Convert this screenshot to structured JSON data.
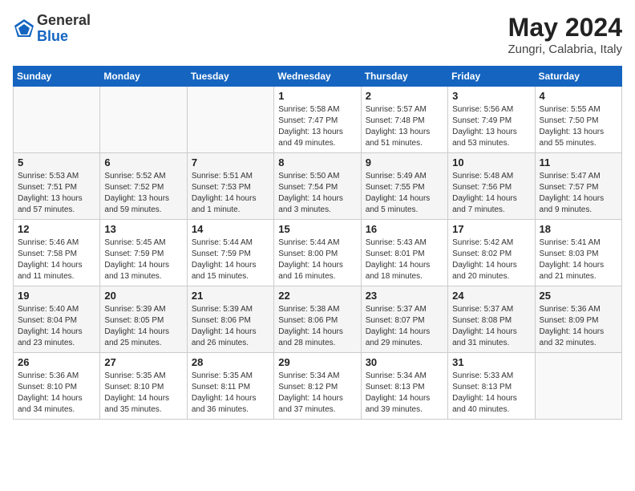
{
  "header": {
    "logo_general": "General",
    "logo_blue": "Blue",
    "month_title": "May 2024",
    "location": "Zungri, Calabria, Italy"
  },
  "weekdays": [
    "Sunday",
    "Monday",
    "Tuesday",
    "Wednesday",
    "Thursday",
    "Friday",
    "Saturday"
  ],
  "weeks": [
    [
      {
        "day": "",
        "info": ""
      },
      {
        "day": "",
        "info": ""
      },
      {
        "day": "",
        "info": ""
      },
      {
        "day": "1",
        "info": "Sunrise: 5:58 AM\nSunset: 7:47 PM\nDaylight: 13 hours\nand 49 minutes."
      },
      {
        "day": "2",
        "info": "Sunrise: 5:57 AM\nSunset: 7:48 PM\nDaylight: 13 hours\nand 51 minutes."
      },
      {
        "day": "3",
        "info": "Sunrise: 5:56 AM\nSunset: 7:49 PM\nDaylight: 13 hours\nand 53 minutes."
      },
      {
        "day": "4",
        "info": "Sunrise: 5:55 AM\nSunset: 7:50 PM\nDaylight: 13 hours\nand 55 minutes."
      }
    ],
    [
      {
        "day": "5",
        "info": "Sunrise: 5:53 AM\nSunset: 7:51 PM\nDaylight: 13 hours\nand 57 minutes."
      },
      {
        "day": "6",
        "info": "Sunrise: 5:52 AM\nSunset: 7:52 PM\nDaylight: 13 hours\nand 59 minutes."
      },
      {
        "day": "7",
        "info": "Sunrise: 5:51 AM\nSunset: 7:53 PM\nDaylight: 14 hours\nand 1 minute."
      },
      {
        "day": "8",
        "info": "Sunrise: 5:50 AM\nSunset: 7:54 PM\nDaylight: 14 hours\nand 3 minutes."
      },
      {
        "day": "9",
        "info": "Sunrise: 5:49 AM\nSunset: 7:55 PM\nDaylight: 14 hours\nand 5 minutes."
      },
      {
        "day": "10",
        "info": "Sunrise: 5:48 AM\nSunset: 7:56 PM\nDaylight: 14 hours\nand 7 minutes."
      },
      {
        "day": "11",
        "info": "Sunrise: 5:47 AM\nSunset: 7:57 PM\nDaylight: 14 hours\nand 9 minutes."
      }
    ],
    [
      {
        "day": "12",
        "info": "Sunrise: 5:46 AM\nSunset: 7:58 PM\nDaylight: 14 hours\nand 11 minutes."
      },
      {
        "day": "13",
        "info": "Sunrise: 5:45 AM\nSunset: 7:59 PM\nDaylight: 14 hours\nand 13 minutes."
      },
      {
        "day": "14",
        "info": "Sunrise: 5:44 AM\nSunset: 7:59 PM\nDaylight: 14 hours\nand 15 minutes."
      },
      {
        "day": "15",
        "info": "Sunrise: 5:44 AM\nSunset: 8:00 PM\nDaylight: 14 hours\nand 16 minutes."
      },
      {
        "day": "16",
        "info": "Sunrise: 5:43 AM\nSunset: 8:01 PM\nDaylight: 14 hours\nand 18 minutes."
      },
      {
        "day": "17",
        "info": "Sunrise: 5:42 AM\nSunset: 8:02 PM\nDaylight: 14 hours\nand 20 minutes."
      },
      {
        "day": "18",
        "info": "Sunrise: 5:41 AM\nSunset: 8:03 PM\nDaylight: 14 hours\nand 21 minutes."
      }
    ],
    [
      {
        "day": "19",
        "info": "Sunrise: 5:40 AM\nSunset: 8:04 PM\nDaylight: 14 hours\nand 23 minutes."
      },
      {
        "day": "20",
        "info": "Sunrise: 5:39 AM\nSunset: 8:05 PM\nDaylight: 14 hours\nand 25 minutes."
      },
      {
        "day": "21",
        "info": "Sunrise: 5:39 AM\nSunset: 8:06 PM\nDaylight: 14 hours\nand 26 minutes."
      },
      {
        "day": "22",
        "info": "Sunrise: 5:38 AM\nSunset: 8:06 PM\nDaylight: 14 hours\nand 28 minutes."
      },
      {
        "day": "23",
        "info": "Sunrise: 5:37 AM\nSunset: 8:07 PM\nDaylight: 14 hours\nand 29 minutes."
      },
      {
        "day": "24",
        "info": "Sunrise: 5:37 AM\nSunset: 8:08 PM\nDaylight: 14 hours\nand 31 minutes."
      },
      {
        "day": "25",
        "info": "Sunrise: 5:36 AM\nSunset: 8:09 PM\nDaylight: 14 hours\nand 32 minutes."
      }
    ],
    [
      {
        "day": "26",
        "info": "Sunrise: 5:36 AM\nSunset: 8:10 PM\nDaylight: 14 hours\nand 34 minutes."
      },
      {
        "day": "27",
        "info": "Sunrise: 5:35 AM\nSunset: 8:10 PM\nDaylight: 14 hours\nand 35 minutes."
      },
      {
        "day": "28",
        "info": "Sunrise: 5:35 AM\nSunset: 8:11 PM\nDaylight: 14 hours\nand 36 minutes."
      },
      {
        "day": "29",
        "info": "Sunrise: 5:34 AM\nSunset: 8:12 PM\nDaylight: 14 hours\nand 37 minutes."
      },
      {
        "day": "30",
        "info": "Sunrise: 5:34 AM\nSunset: 8:13 PM\nDaylight: 14 hours\nand 39 minutes."
      },
      {
        "day": "31",
        "info": "Sunrise: 5:33 AM\nSunset: 8:13 PM\nDaylight: 14 hours\nand 40 minutes."
      },
      {
        "day": "",
        "info": ""
      }
    ]
  ]
}
